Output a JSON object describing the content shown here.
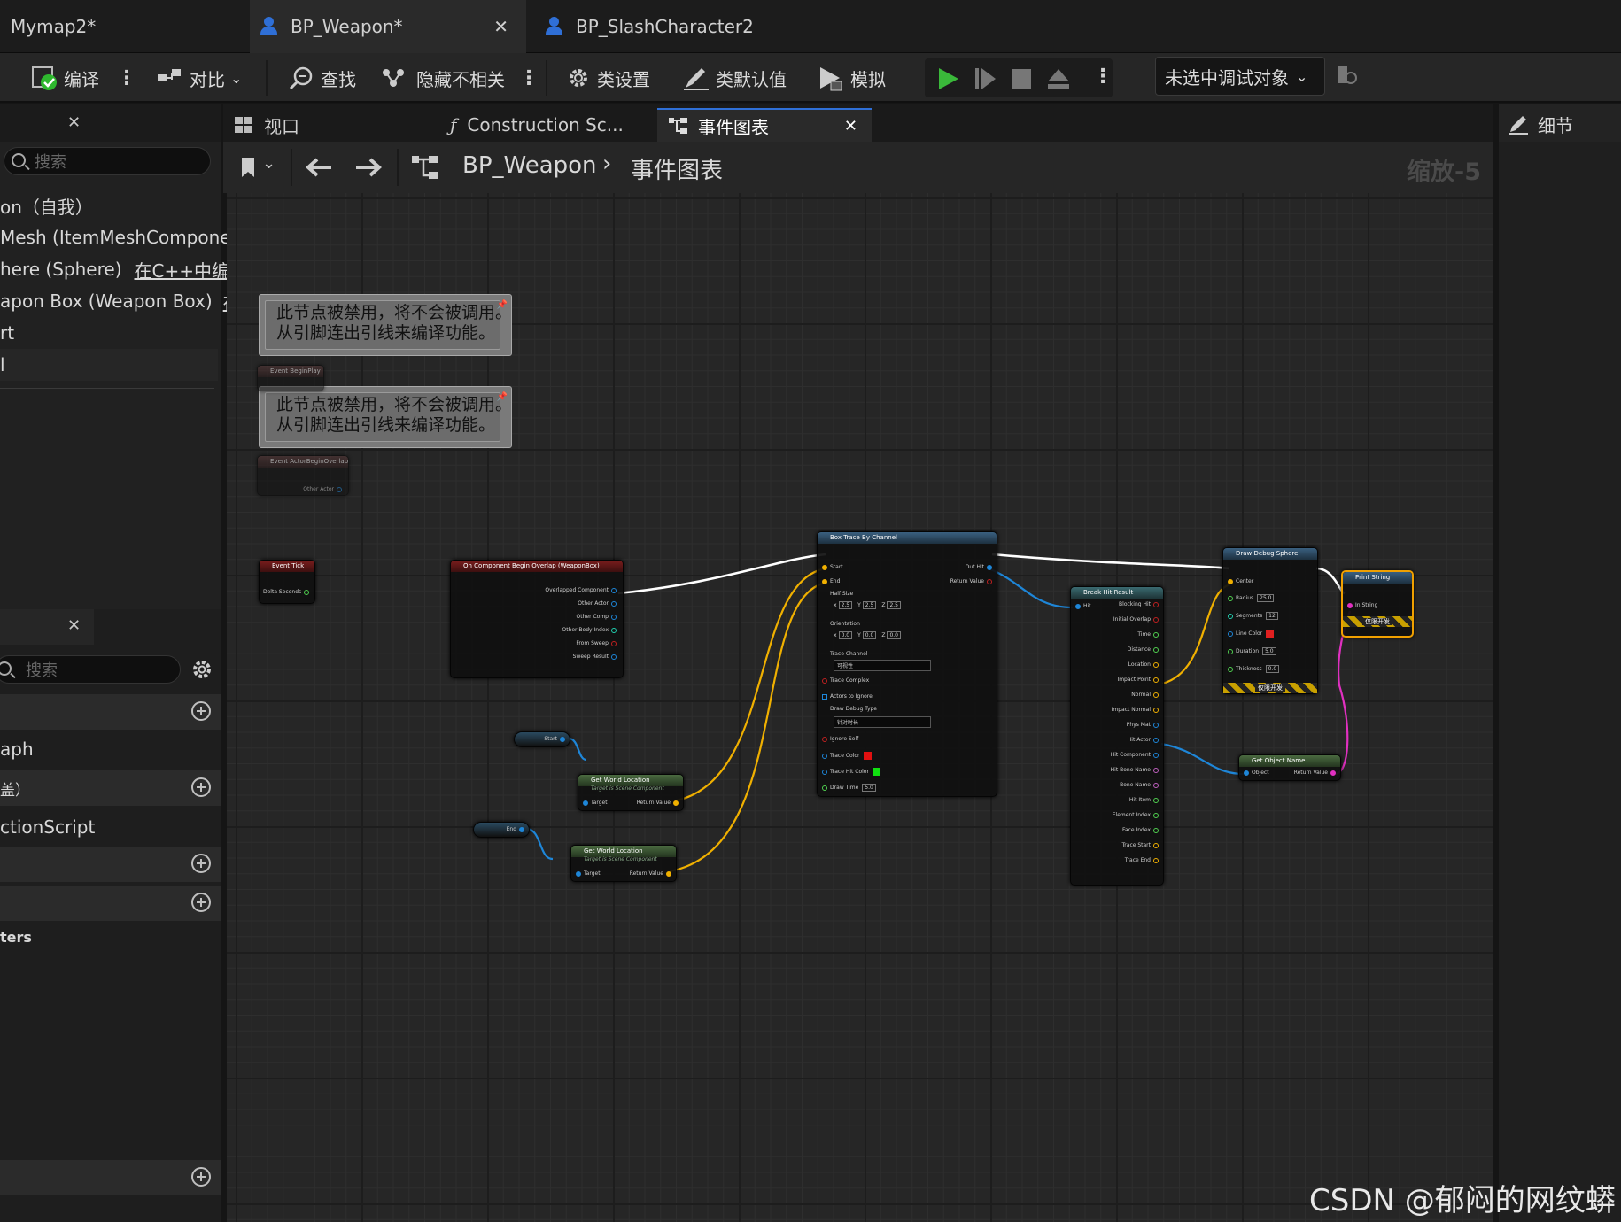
{
  "doc_tabs": [
    {
      "label": "Mymap2*"
    },
    {
      "label": "BP_Weapon*"
    },
    {
      "label": "BP_SlashCharacter2"
    }
  ],
  "toolbar": {
    "compile": "编译",
    "diff": "对比",
    "find": "查找",
    "hide_unrelated": "隐藏不相关",
    "class_settings": "类设置",
    "class_defaults": "类默认值",
    "simulate": "模拟",
    "debug_target": "未选中调试对象"
  },
  "graph_tabs": [
    {
      "label": "视口"
    },
    {
      "label": "Construction Sc..."
    },
    {
      "label": "事件图表"
    }
  ],
  "breadcrumb": {
    "blueprint": "BP_Weapon",
    "graph": "事件图表",
    "zoom": "缩放-5"
  },
  "details": {
    "label": "细节"
  },
  "components": {
    "search_placeholder": "搜索",
    "items": [
      "on（自我）",
      "Mesh (ItemMeshComponent",
      "here (Sphere)",
      "apon Box (Weapon Box)",
      "rt",
      "l"
    ],
    "edit_in_cpp": "在C++中编辑",
    "edit_in_cpp_trunc": "在("
  },
  "my_blueprint": {
    "search_placeholder": "搜索",
    "rows": [
      "aph",
      "盖）",
      "ctionScript",
      "ters"
    ]
  },
  "comments": [
    "此节点被禁用，将不会被调用。\n从引脚连出引线来编译功能。",
    "此节点被禁用，将不会被调用。\n从引脚连出引线来编译功能。"
  ],
  "nodes": {
    "begin_play": {
      "title": "Event BeginPlay"
    },
    "actor_overlap": {
      "title": "Event ActorBeginOverlap",
      "pin": "Other Actor"
    },
    "event_tick": {
      "title": "Event Tick",
      "pin": "Delta Seconds"
    },
    "on_overlap": {
      "title": "On Component Begin Overlap (WeaponBox)",
      "pins": [
        "Overlapped Component",
        "Other Actor",
        "Other Comp",
        "Other Body Index",
        "From Sweep",
        "Sweep Result"
      ]
    },
    "start_var": {
      "label": "Start"
    },
    "end_var": {
      "label": "End"
    },
    "gwl1": {
      "title": "Get World Location",
      "subtitle": "Target is Scene Component",
      "in": "Target",
      "out": "Return Value"
    },
    "gwl2": {
      "title": "Get World Location",
      "subtitle": "Target is Scene Component",
      "in": "Target",
      "out": "Return Value"
    },
    "box_trace": {
      "title": "Box Trace By Channel",
      "pins": [
        "Start",
        "End",
        "Half Size",
        "Orientation",
        "Trace Channel",
        "Trace Complex",
        "Actors to Ignore",
        "Draw Debug Type",
        "Ignore Self",
        "Trace Color",
        "Trace Hit Color",
        "Draw Time"
      ],
      "out": [
        "Out Hit",
        "Return Value"
      ],
      "half": [
        "2.5",
        "2.5",
        "2.5"
      ],
      "orient": [
        "0.0",
        "0.0",
        "0.0"
      ],
      "channel": "可视性",
      "debug_type": "针对时长",
      "draw_time": "5.0"
    },
    "break_hit": {
      "title": "Break Hit Result",
      "in": "Hit",
      "pins": [
        "Blocking Hit",
        "Initial Overlap",
        "Time",
        "Distance",
        "Location",
        "Impact Point",
        "Normal",
        "Impact Normal",
        "Phys Mat",
        "Hit Actor",
        "Hit Component",
        "Hit Bone Name",
        "Bone Name",
        "Hit Item",
        "Element Index",
        "Face Index",
        "Trace Start",
        "Trace End"
      ]
    },
    "debug_sphere": {
      "title": "Draw Debug Sphere",
      "pins": [
        "Center",
        "Radius",
        "Segments",
        "Line Color",
        "Duration",
        "Thickness"
      ],
      "vals": [
        "25.0",
        "12",
        "",
        "5.0",
        "0.0"
      ],
      "dev": "仅限开发"
    },
    "print_string": {
      "title": "Print String",
      "pin": "In String",
      "dev": "仅限开发"
    },
    "get_name": {
      "title": "Get Object Name",
      "in": "Object",
      "out": "Return Value"
    }
  },
  "watermark": "CSDN @郁闷的网纹蟒"
}
